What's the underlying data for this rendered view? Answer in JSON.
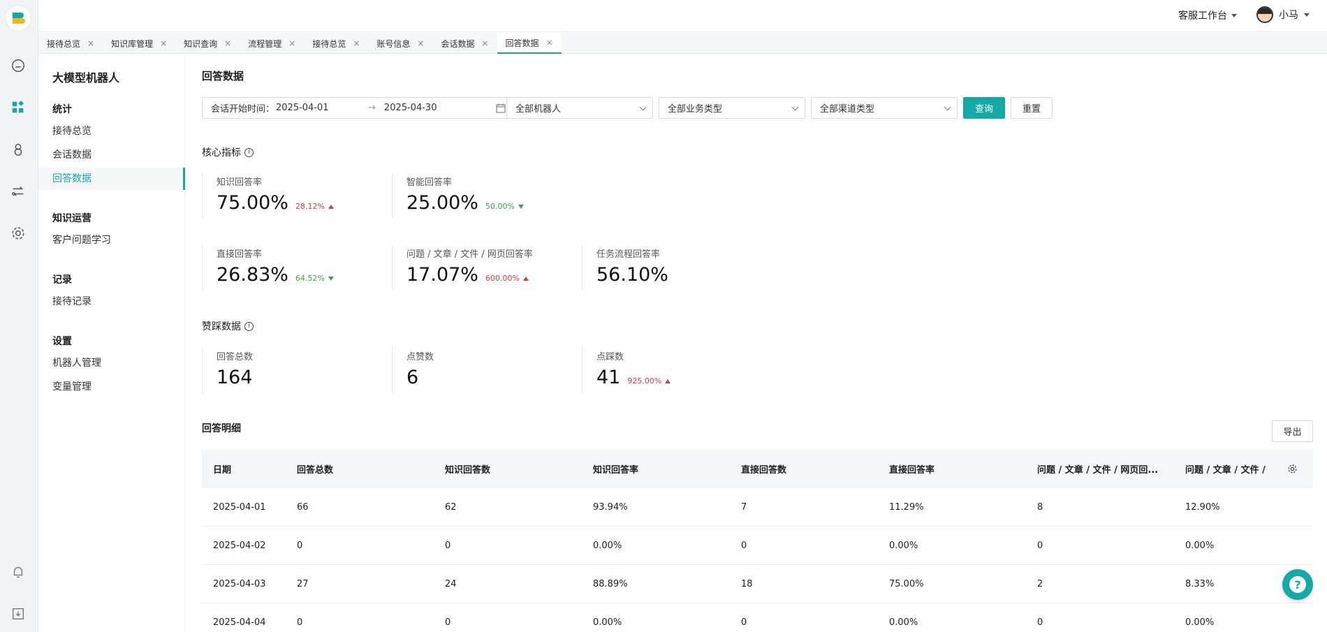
{
  "colors": {
    "accent": "#14a9a4",
    "up": "#d13f3f",
    "down": "#3ba34a"
  },
  "topbar": {
    "workspace": "客服工作台",
    "user_name": "小马"
  },
  "tabs": [
    {
      "label": "接待总览"
    },
    {
      "label": "知识库管理"
    },
    {
      "label": "知识查询"
    },
    {
      "label": "流程管理"
    },
    {
      "label": "接待总览"
    },
    {
      "label": "账号信息"
    },
    {
      "label": "会话数据"
    },
    {
      "label": "回答数据"
    }
  ],
  "tab_close_glyph": "×",
  "sidebar": {
    "title": "大模型机器人",
    "groups": [
      {
        "label": "统计",
        "items": [
          "接待总览",
          "会话数据",
          "回答数据"
        ]
      },
      {
        "label": "知识运营",
        "items": [
          "客户问题学习"
        ]
      },
      {
        "label": "记录",
        "items": [
          "接待记录"
        ]
      },
      {
        "label": "设置",
        "items": [
          "机器人管理",
          "变量管理"
        ]
      }
    ]
  },
  "page": {
    "title": "回答数据",
    "filters": {
      "date_label": "会话开始时间：",
      "date_start": "2025-04-01",
      "date_sep": "→",
      "date_end": "2025-04-30",
      "robot": "全部机器人",
      "biz_type": "全部业务类型",
      "channel": "全部渠道类型",
      "query_btn": "查询",
      "reset_btn": "重置"
    },
    "core_title": "核心指标",
    "core_metrics": [
      {
        "label": "知识回答率",
        "value": "75.00%",
        "change": "28.12%",
        "dir": "up"
      },
      {
        "label": "智能回答率",
        "value": "25.00%",
        "change": "50.00%",
        "dir": "down"
      },
      {
        "label": "直接回答率",
        "value": "26.83%",
        "change": "64.52%",
        "dir": "down"
      },
      {
        "label": "问题 / 文章 / 文件 / 网页回答率",
        "value": "17.07%",
        "change": "600.00%",
        "dir": "up"
      },
      {
        "label": "任务流程回答率",
        "value": "56.10%",
        "change": "",
        "dir": ""
      }
    ],
    "vote_title": "赞踩数据",
    "vote_metrics": [
      {
        "label": "回答总数",
        "value": "164",
        "change": "",
        "dir": ""
      },
      {
        "label": "点赞数",
        "value": "6",
        "change": "",
        "dir": ""
      },
      {
        "label": "点踩数",
        "value": "41",
        "change": "925.00%",
        "dir": "up"
      }
    ],
    "detail_title": "回答明细",
    "export_btn": "导出",
    "table": {
      "headers": [
        "日期",
        "回答总数",
        "知识回答数",
        "知识回答率",
        "直接回答数",
        "直接回答率",
        "问题 / 文章 / 文件 / 网页回...",
        "问题 / 文章 / 文件 /"
      ],
      "rows": [
        [
          "2025-04-01",
          "66",
          "62",
          "93.94%",
          "7",
          "11.29%",
          "8",
          "12.90%"
        ],
        [
          "2025-04-02",
          "0",
          "0",
          "0.00%",
          "0",
          "0.00%",
          "0",
          "0.00%"
        ],
        [
          "2025-04-03",
          "27",
          "24",
          "88.89%",
          "18",
          "75.00%",
          "2",
          "8.33%"
        ],
        [
          "2025-04-04",
          "0",
          "0",
          "0.00%",
          "0",
          "0.00%",
          "0",
          "0.00%"
        ]
      ]
    }
  },
  "help_glyph": "?"
}
